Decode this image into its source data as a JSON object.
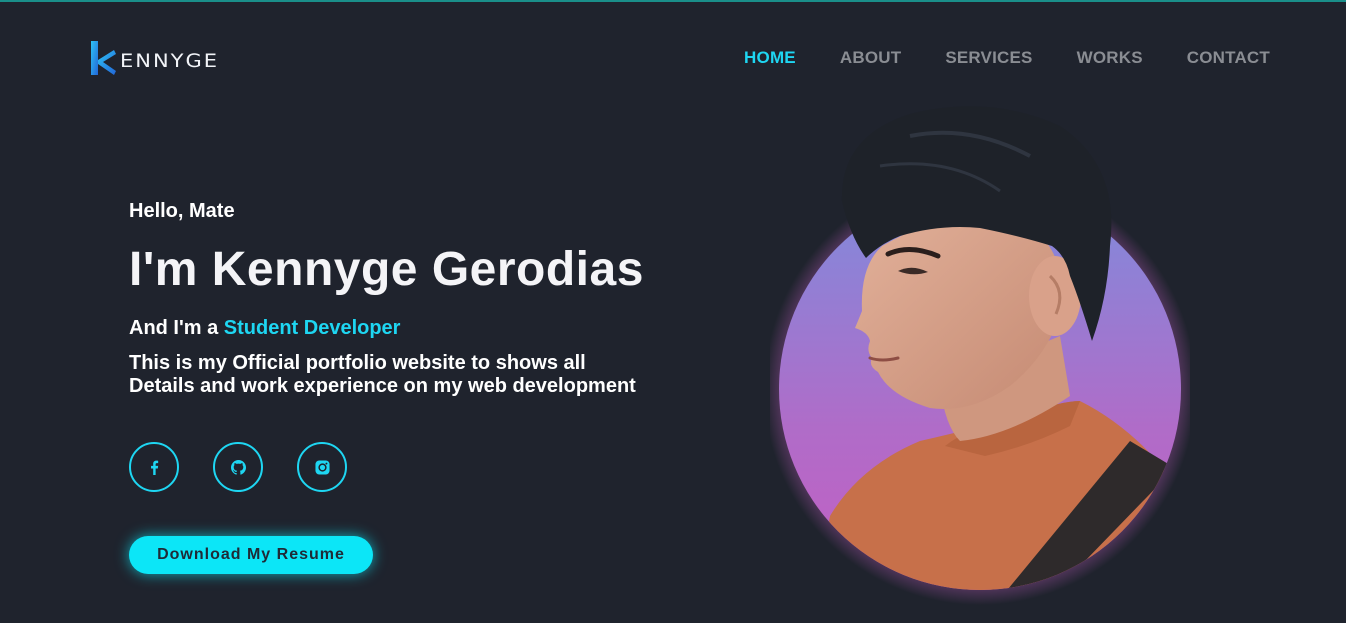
{
  "brand": {
    "mark": "K",
    "text": "ENNYGE"
  },
  "nav": {
    "items": [
      {
        "label": "HOME",
        "active": true
      },
      {
        "label": "ABOUT",
        "active": false
      },
      {
        "label": "SERVICES",
        "active": false
      },
      {
        "label": "WORKS",
        "active": false
      },
      {
        "label": "CONTACT",
        "active": false
      }
    ]
  },
  "hero": {
    "greeting": "Hello, Mate",
    "name": "I'm Kennyge Gerodias",
    "role_prefix": "And I'm a ",
    "role_highlight": "Student Developer",
    "description_line1": "This is my Official portfolio website to shows all",
    "description_line2": "Details and work experience on my web development"
  },
  "socials": [
    {
      "icon": "facebook-icon"
    },
    {
      "icon": "github-icon"
    },
    {
      "icon": "instagram-icon"
    }
  ],
  "cta": {
    "label": "Download My Resume"
  },
  "colors": {
    "background": "#1f232d",
    "accent": "#1ed6f2",
    "nav_inactive": "#8a8d93",
    "portrait_gradient_top": "#7d86dc",
    "portrait_gradient_bottom": "#c264c8"
  }
}
